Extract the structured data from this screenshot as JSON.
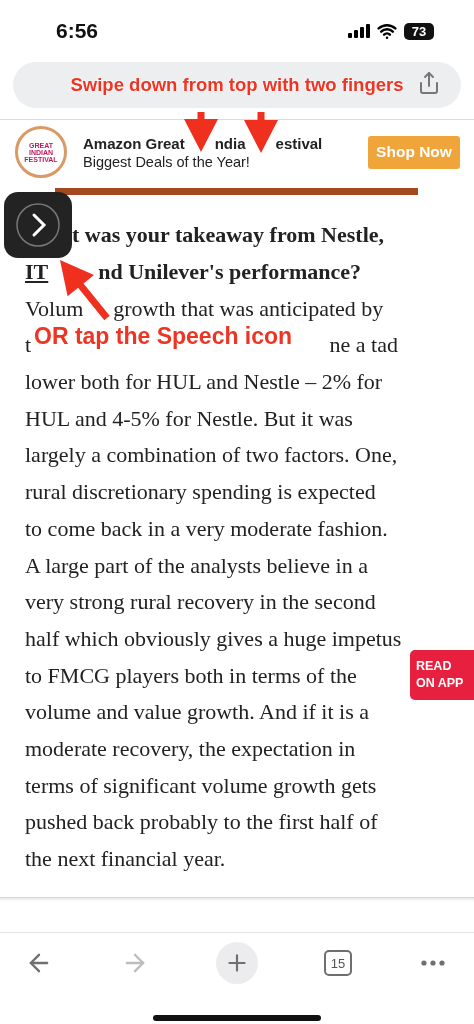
{
  "status_bar": {
    "time": "6:56",
    "battery": "73"
  },
  "address_bar": {
    "annotation": "Swipe down from top with two fingers"
  },
  "ad": {
    "logo_lines": [
      "GREAT",
      "INDIAN",
      "FESTIVAL"
    ],
    "title_parts": [
      "Amazon Great",
      "ndia",
      "estival"
    ],
    "subtitle": "Biggest Deals of the Year!",
    "button": "Shop Now"
  },
  "article": {
    "heading_lines": [
      {
        "parts": [
          {
            "text": "t was your takeaway from Nestle,",
            "link": false
          }
        ]
      },
      {
        "parts": [
          {
            "text": "IT",
            "link": true
          },
          {
            "text": "nd Unilever's performance?",
            "link": false
          }
        ]
      }
    ],
    "lines": [
      {
        "parts": [
          "Volum",
          "growth that was anticipated by"
        ]
      },
      {
        "parts": [
          "t",
          "ne a tad"
        ]
      },
      {
        "parts": [
          "lower both for HUL and Nestle – 2% for"
        ]
      },
      {
        "parts": [
          "HUL and 4-5% for Nestle. But it was"
        ]
      },
      {
        "parts": [
          "largely a combination of two factors. One,"
        ]
      },
      {
        "parts": [
          "rural discretionary spending is expected"
        ]
      },
      {
        "parts": [
          "to come back in a very moderate fashion."
        ]
      },
      {
        "parts": [
          "A large part of the analysts believe in a"
        ]
      },
      {
        "parts": [
          "very strong rural recovery in the second"
        ]
      },
      {
        "parts": [
          "half which obviously gives a huge impetus"
        ]
      },
      {
        "parts": [
          "to FMCG players both in terms of the"
        ]
      },
      {
        "parts": [
          "volume and value growth. And if it is a"
        ]
      },
      {
        "parts": [
          "moderate recovery, the expectation in"
        ]
      },
      {
        "parts": [
          "terms of significant volume growth gets"
        ]
      },
      {
        "parts": [
          "pushed back probably to the first half of"
        ]
      },
      {
        "parts": [
          "the next financial year."
        ]
      }
    ]
  },
  "annotation": "OR tap the Speech icon",
  "read_app_button": {
    "lines": [
      "READ",
      "ON APP"
    ]
  },
  "toolbar": {
    "items": [
      {
        "kind": "back",
        "disabled": false
      },
      {
        "kind": "forward",
        "disabled": true
      },
      {
        "kind": "new-tab"
      },
      {
        "kind": "tabs",
        "label": "15"
      },
      {
        "kind": "more"
      }
    ]
  }
}
